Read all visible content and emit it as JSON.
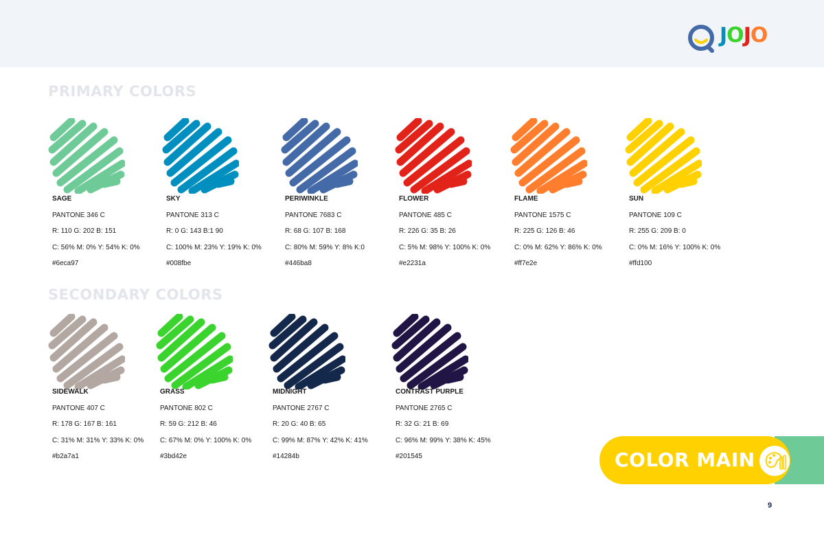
{
  "brand": {
    "logo_letters": [
      "J",
      "O",
      "J",
      "O"
    ],
    "logo_colors": [
      "#008fbe",
      "#3bd42e",
      "#e2231a",
      "#ff7e2e",
      "#446ba8"
    ]
  },
  "sections": {
    "primary_title": "PRIMARY COLORS",
    "secondary_title": "SECONDARY COLORS"
  },
  "primary": [
    {
      "name": "SAGE",
      "pantone": "PANTONE 346 C",
      "rgb": "R: 110  G: 202  B: 151",
      "cmyk": "C: 56%  M: 0%  Y: 54%  K: 0%",
      "hex": "#6eca97",
      "color": "#6eca97"
    },
    {
      "name": "SKY",
      "pantone": "PANTONE 313 C",
      "rgb": "R: 0  G: 143  B:1 90",
      "cmyk": "C: 100%  M: 23%  Y: 19%  K: 0%",
      "hex": "#008fbe",
      "color": "#008fbe"
    },
    {
      "name": "PERIWINKLE",
      "pantone": "PANTONE 7683 C",
      "rgb": "R: 68 G: 107 B: 168",
      "cmyk": "C: 80% M: 59% Y: 8% K:0",
      "hex": "#446ba8",
      "color": "#446ba8"
    },
    {
      "name": "FLOWER",
      "pantone": "PANTONE 485 C",
      "rgb": "R: 226  G: 35  B: 26",
      "cmyk": "C: 5%  M: 98%  Y: 100%  K: 0%",
      "hex": "#e2231a",
      "color": "#e2231a"
    },
    {
      "name": "FLAME",
      "pantone": "PANTONE 1575 C",
      "rgb": "R: 225  G: 126  B: 46",
      "cmyk": "C: 0%  M: 62%  Y: 86%  K: 0%",
      "hex": "#ff7e2e",
      "color": "#ff7e2e"
    },
    {
      "name": "SUN",
      "pantone": "PANTONE 109 C",
      "rgb": "R: 255  G: 209  B: 0",
      "cmyk": "C: 0%  M: 16%  Y: 100%  K: 0%",
      "hex": "#ffd100",
      "color": "#ffd100"
    }
  ],
  "secondary": [
    {
      "name": "SIDEWALK",
      "pantone": "PANTONE 407 C",
      "rgb": "R: 178  G: 167  B: 161",
      "cmyk": "C: 31%  M: 31%  Y: 33%  K: 0%",
      "hex": "#b2a7a1",
      "color": "#b2a7a1"
    },
    {
      "name": "GRASS",
      "pantone": "PANTONE 802 C",
      "rgb": "R: 59  G: 212  B: 46",
      "cmyk": "C: 67%  M: 0%  Y: 100%  K: 0%",
      "hex": "#3bd42e",
      "color": "#3bd42e"
    },
    {
      "name": "MIDNIGHT",
      "pantone": "PANTONE 2767 C",
      "rgb": "R: 20  G: 40 B: 65",
      "cmyk": "C: 99%  M: 87%  Y: 42%  K: 41%",
      "hex": "#14284b",
      "color": "#14284b"
    },
    {
      "name": "CONTRAST PURPLE",
      "pantone": "PANTONE 2765 C",
      "rgb": "R: 32  G: 21 B: 69",
      "cmyk": "C: 96%  M: 99%  Y: 38%  K: 45%",
      "hex": "#201545",
      "color": "#201545"
    }
  ],
  "badge": {
    "label": "COLOR MAIN",
    "icon": "palette-brush-icon",
    "colors": {
      "pill": "#ffd100",
      "tab": "#6eca97"
    }
  },
  "footer": {
    "page_number": "9"
  }
}
